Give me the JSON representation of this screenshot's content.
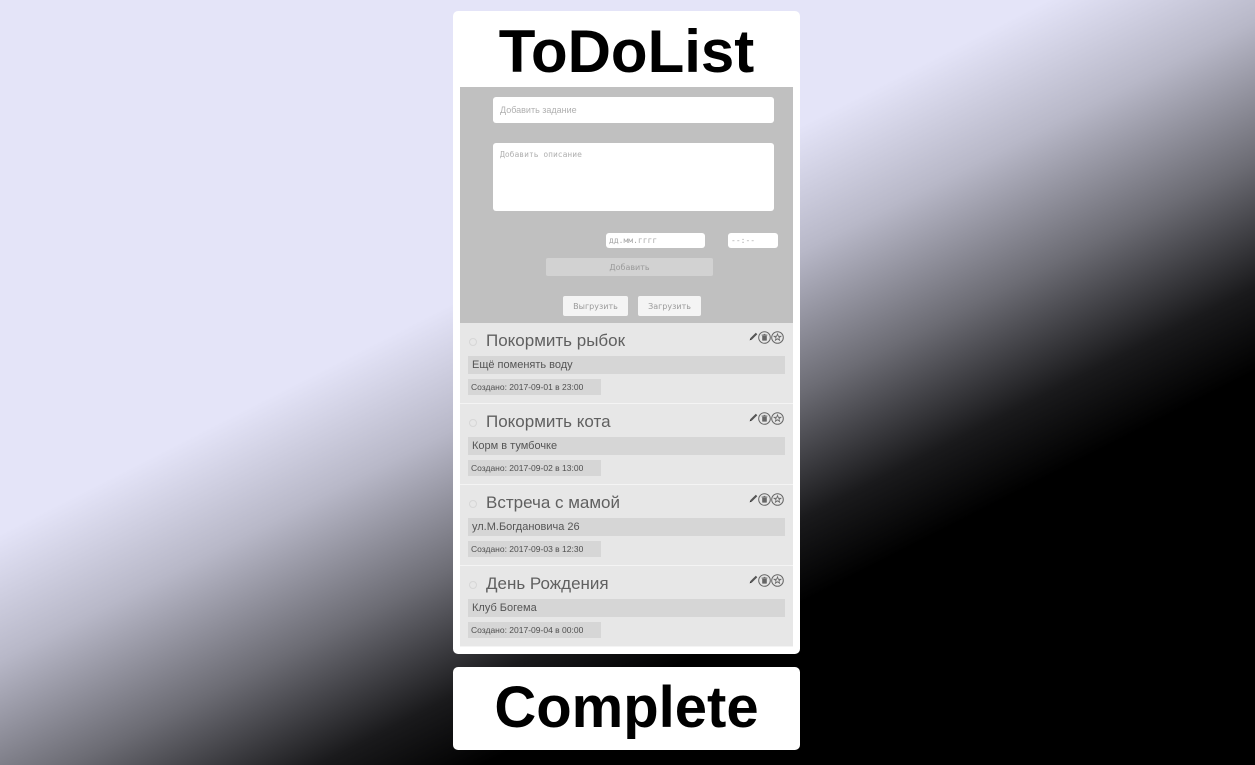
{
  "app": {
    "title": "ToDoList",
    "complete_label": "Complete"
  },
  "form": {
    "task_placeholder": "Добавить задание",
    "description_placeholder": "Добавить описание",
    "date_placeholder": "дд.мм.гггг",
    "time_placeholder": "--:--",
    "add_label": "Добавить",
    "export_label": "Выгрузить",
    "import_label": "Загрузить"
  },
  "tasks": [
    {
      "title": "Покормить рыбок",
      "description": "Ещё поменять воду",
      "created": "Создано: 2017-09-01 в 23:00",
      "done": false
    },
    {
      "title": "Покормить кота",
      "description": "Корм в тумбочке",
      "created": "Создано: 2017-09-02 в 13:00",
      "done": false
    },
    {
      "title": "Встреча с мамой",
      "description": "ул.М.Богдановича 26",
      "created": "Создано: 2017-09-03 в 12:30",
      "done": false
    },
    {
      "title": "День Рождения",
      "description": "Клуб Богема",
      "created": "Создано: 2017-09-04 в 00:00",
      "done": false
    }
  ],
  "icons": {
    "edit": "pencil-icon",
    "delete": "trash-icon",
    "favorite": "star-icon"
  },
  "colors": {
    "panel": "#c0c0c0",
    "task_bg": "#e7e7e7",
    "field_bg": "#d6d6d6"
  }
}
